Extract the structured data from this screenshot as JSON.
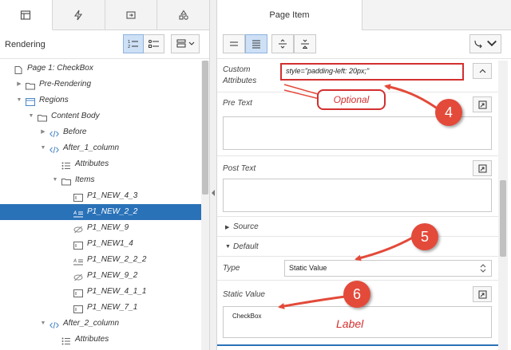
{
  "left": {
    "tabs": [
      {
        "icon": "rendering-tab-icon"
      },
      {
        "icon": "dynamic-actions-tab-icon"
      },
      {
        "icon": "processing-tab-icon"
      },
      {
        "icon": "shared-components-tab-icon"
      }
    ],
    "toolbar_title": "Rendering",
    "tree": [
      {
        "label": "Page 1: CheckBox",
        "indent": 0,
        "toggle": "",
        "icon": "page-icon"
      },
      {
        "label": "Pre-Rendering",
        "indent": 1,
        "toggle": "▶",
        "icon": "folder-icon"
      },
      {
        "label": "Regions",
        "indent": 1,
        "toggle": "▼",
        "icon": "region-icon"
      },
      {
        "label": "Content Body",
        "indent": 2,
        "toggle": "▼",
        "icon": "folder-icon"
      },
      {
        "label": "Before",
        "indent": 3,
        "toggle": "▶",
        "icon": "code-icon"
      },
      {
        "label": "After_1_column",
        "indent": 3,
        "toggle": "▼",
        "icon": "code-icon"
      },
      {
        "label": "Attributes",
        "indent": 4,
        "toggle": "",
        "icon": "list-icon"
      },
      {
        "label": "Items",
        "indent": 4,
        "toggle": "▼",
        "icon": "folder-icon"
      },
      {
        "label": "P1_NEW_4_3",
        "indent": 5,
        "toggle": "",
        "icon": "text-item-icon"
      },
      {
        "label": "P1_NEW_2_2",
        "indent": 5,
        "toggle": "",
        "icon": "display-item-icon",
        "selected": true
      },
      {
        "label": "P1_NEW_9",
        "indent": 5,
        "toggle": "",
        "icon": "hidden-item-icon"
      },
      {
        "label": "P1_NEW1_4",
        "indent": 5,
        "toggle": "",
        "icon": "text-item-icon"
      },
      {
        "label": "P1_NEW_2_2_2",
        "indent": 5,
        "toggle": "",
        "icon": "display-item-icon"
      },
      {
        "label": "P1_NEW_9_2",
        "indent": 5,
        "toggle": "",
        "icon": "hidden-item-icon"
      },
      {
        "label": "P1_NEW_4_1_1",
        "indent": 5,
        "toggle": "",
        "icon": "text-item-icon"
      },
      {
        "label": "P1_NEW_7_1",
        "indent": 5,
        "toggle": "",
        "icon": "text-item-icon"
      },
      {
        "label": "After_2_column",
        "indent": 3,
        "toggle": "▼",
        "icon": "code-icon"
      },
      {
        "label": "Attributes",
        "indent": 4,
        "toggle": "",
        "icon": "list-icon"
      }
    ]
  },
  "right": {
    "tab_title": "Page Item",
    "custom_attributes": {
      "label_line1": "Custom",
      "label_line2": "Attributes",
      "value": "style=\"padding-left: 20px;\""
    },
    "pre_text": {
      "label": "Pre Text",
      "value": ""
    },
    "post_text": {
      "label": "Post Text",
      "value": ""
    },
    "source_section": "Source",
    "default_section": "Default",
    "type": {
      "label": "Type",
      "value": "Static Value"
    },
    "static_value": {
      "label": "Static Value",
      "value": "CheckBox"
    }
  },
  "annotations": {
    "optional": "Optional",
    "step4": "4",
    "step5": "5",
    "step6": "6",
    "label_note": "Label",
    "color": "#d32f2f"
  }
}
